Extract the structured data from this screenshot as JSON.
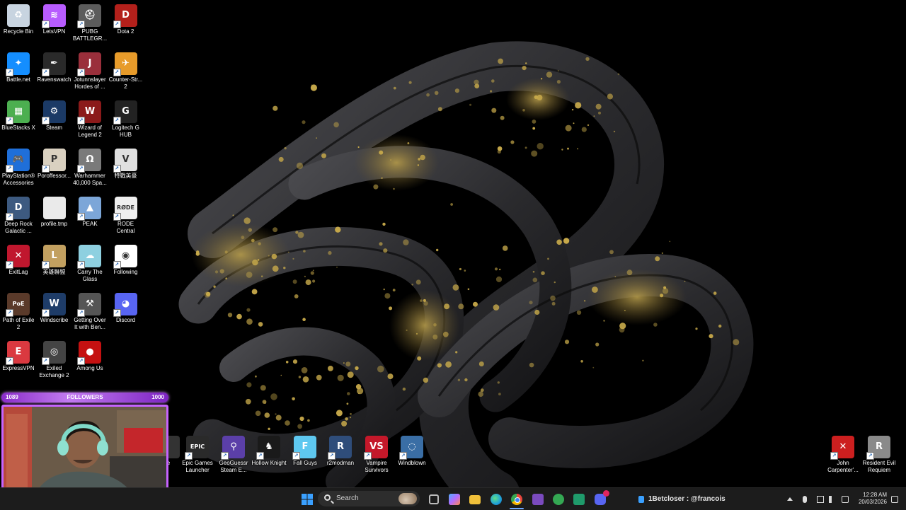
{
  "desktop": {
    "icons": [
      {
        "label": "Recycle Bin",
        "icon": "recycle-bin-icon",
        "color": "#c8d4e0",
        "glyph": "♻",
        "shortcut": false
      },
      {
        "label": "LetsVPN",
        "icon": "letsvpn-icon",
        "color": "#b85cff",
        "glyph": "≋",
        "shortcut": true
      },
      {
        "label": "PUBG BATTLEGR...",
        "icon": "pubg-icon",
        "color": "#5c5c5c",
        "glyph": "⛑",
        "shortcut": true
      },
      {
        "label": "Dota 2",
        "icon": "dota2-icon",
        "color": "#b3201b",
        "glyph": "D",
        "shortcut": true
      },
      {
        "label": "Battle.net",
        "icon": "battlenet-icon",
        "color": "#148eff",
        "glyph": "✦",
        "shortcut": true
      },
      {
        "label": "Ravenswatch",
        "icon": "ravenswatch-icon",
        "color": "#2a2a2a",
        "glyph": "✒",
        "shortcut": true
      },
      {
        "label": "Jotunnslayer Hordes of ...",
        "icon": "jotunnslayer-icon",
        "color": "#9a2f3b",
        "glyph": "J",
        "shortcut": true
      },
      {
        "label": "Counter-Str... 2",
        "icon": "counter-strike-icon",
        "color": "#e79b2a",
        "glyph": "✈",
        "shortcut": true
      },
      {
        "label": "BlueStacks X",
        "icon": "bluestacks-icon",
        "color": "#4caf50",
        "glyph": "▦",
        "shortcut": true
      },
      {
        "label": "Steam",
        "icon": "steam-icon",
        "color": "#1b3a66",
        "glyph": "⚙",
        "shortcut": true
      },
      {
        "label": "Wizard of Legend 2",
        "icon": "wizard-of-legend-icon",
        "color": "#8b1a1a",
        "glyph": "W",
        "shortcut": true
      },
      {
        "label": "Logitech G HUB",
        "icon": "logitech-icon",
        "color": "#222",
        "glyph": "G",
        "shortcut": true
      },
      {
        "label": "PlayStation® Accessories",
        "icon": "playstation-icon",
        "color": "#1f6fd9",
        "glyph": "🎮",
        "shortcut": true
      },
      {
        "label": "Poroffessor...",
        "icon": "poroffessor-icon",
        "color": "#d9d0c0",
        "glyph": "P",
        "shortcut": true
      },
      {
        "label": "Warhammer 40,000 Spa...",
        "icon": "warhammer-icon",
        "color": "#7a7a7a",
        "glyph": "Ω",
        "shortcut": true
      },
      {
        "label": "特戰英豪",
        "icon": "valorant-icon",
        "color": "#e0e0e0",
        "glyph": "V",
        "shortcut": true
      },
      {
        "label": "Deep Rock Galactic ...",
        "icon": "deep-rock-icon",
        "color": "#3d5a80",
        "glyph": "D",
        "shortcut": true
      },
      {
        "label": "profile.tmp",
        "icon": "file-icon",
        "color": "#eaeaea",
        "glyph": "",
        "shortcut": false
      },
      {
        "label": "PEAK",
        "icon": "peak-icon",
        "color": "#7ca6d8",
        "glyph": "▲",
        "shortcut": true
      },
      {
        "label": "RODE Central",
        "icon": "rode-icon",
        "color": "#efefef",
        "glyph": "RØDE",
        "shortcut": true
      },
      {
        "label": "ExitLag",
        "icon": "exitlag-icon",
        "color": "#c0172e",
        "glyph": "✕",
        "shortcut": true
      },
      {
        "label": "英雄聯盟",
        "icon": "league-icon",
        "color": "#c2a060",
        "glyph": "L",
        "shortcut": true
      },
      {
        "label": "Carry The Glass",
        "icon": "carry-the-glass-icon",
        "color": "#8ed0e0",
        "glyph": "☁",
        "shortcut": true
      },
      {
        "label": "Following",
        "icon": "chrome-icon",
        "color": "#ffffff",
        "glyph": "◉",
        "shortcut": true
      },
      {
        "label": "Path of Exile 2",
        "icon": "path-of-exile-icon",
        "color": "#5a3a2a",
        "glyph": "PoE",
        "shortcut": true
      },
      {
        "label": "Windscribe",
        "icon": "windscribe-icon",
        "color": "#1e3c68",
        "glyph": "W",
        "shortcut": true
      },
      {
        "label": "Getting Over It with Ben...",
        "icon": "getting-over-it-icon",
        "color": "#555",
        "glyph": "⚒",
        "shortcut": true
      },
      {
        "label": "Discord",
        "icon": "discord-icon",
        "color": "#5865f2",
        "glyph": "◕",
        "shortcut": true
      },
      {
        "label": "ExpressVPN",
        "icon": "expressvpn-icon",
        "color": "#da3940",
        "glyph": "E",
        "shortcut": true
      },
      {
        "label": "Exiled Exchange 2",
        "icon": "exiled-exchange-icon",
        "color": "#444",
        "glyph": "◎",
        "shortcut": true
      },
      {
        "label": "Among Us",
        "icon": "among-us-icon",
        "color": "#c51111",
        "glyph": "●",
        "shortcut": true
      }
    ],
    "bottom_icons": [
      {
        "label": "e",
        "icon": "cut-off-app-icon",
        "color": "#333",
        "glyph": "",
        "shortcut": false
      },
      {
        "label": "Epic Games Launcher",
        "icon": "epic-games-icon",
        "color": "#2a2a2a",
        "glyph": "EPIC",
        "shortcut": true
      },
      {
        "label": "GeoGuessr Steam E...",
        "icon": "geoguessr-icon",
        "color": "#5b3fa8",
        "glyph": "⚲",
        "shortcut": true
      },
      {
        "label": "Hollow Knight",
        "icon": "hollow-knight-icon",
        "color": "#1a1a1a",
        "glyph": "♞",
        "shortcut": true
      },
      {
        "label": "Fall Guys",
        "icon": "fall-guys-icon",
        "color": "#5ec8f0",
        "glyph": "F",
        "shortcut": true
      },
      {
        "label": "r2modman",
        "icon": "r2modman-icon",
        "color": "#2f4d7a",
        "glyph": "R",
        "shortcut": true
      },
      {
        "label": "Vampire Survivors",
        "icon": "vampire-survivors-icon",
        "color": "#c4182a",
        "glyph": "VS",
        "shortcut": true
      },
      {
        "label": "Windblown",
        "icon": "windblown-icon",
        "color": "#3a6ea5",
        "glyph": "◌",
        "shortcut": true
      },
      {
        "label": "John Carpenter'...",
        "icon": "john-carpenter-icon",
        "color": "#cc1f1f",
        "glyph": "✕",
        "shortcut": true
      },
      {
        "label": "Resident Evil Requiem",
        "icon": "resident-evil-icon",
        "color": "#8a8a8a",
        "glyph": "R",
        "shortcut": true
      }
    ]
  },
  "overlay": {
    "followers_current": "1089",
    "followers_label": "FOLLOWERS",
    "followers_goal": "1000",
    "followers_progress": 1.0
  },
  "taskbar": {
    "search_placeholder": "Search",
    "streamer_text": "1Betcloser : @francois",
    "time": "12:28 AM",
    "date": "20/03/2026",
    "apps": [
      {
        "name": "start-button",
        "color": "#3aa0ff"
      },
      {
        "name": "search",
        "color": "#2d2d2d"
      },
      {
        "name": "task-view-icon",
        "color": "#bbbbbb"
      },
      {
        "name": "copilot-icon",
        "color": "#9b6cff"
      },
      {
        "name": "file-explorer-icon",
        "color": "#f0c03a"
      },
      {
        "name": "edge-icon",
        "color": "#1fa0d8"
      },
      {
        "name": "chrome-icon",
        "color": "#e8453c"
      },
      {
        "name": "obs-icon",
        "color": "#7b4bbf"
      },
      {
        "name": "xbox-icon",
        "color": "#34a853"
      },
      {
        "name": "app-green-icon",
        "color": "#1f9b6b"
      },
      {
        "name": "discord-icon",
        "color": "#5865f2"
      }
    ]
  }
}
